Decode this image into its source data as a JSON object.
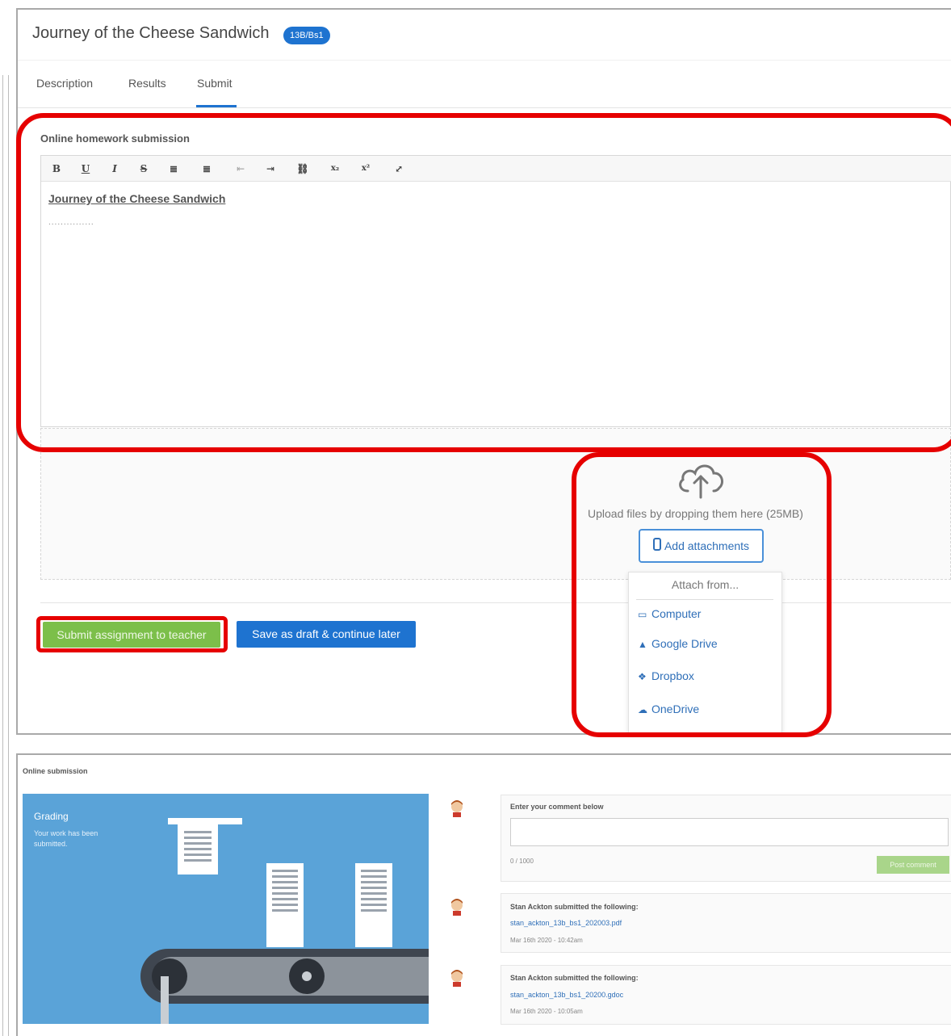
{
  "assignment": {
    "title": "Journey of the Cheese Sandwich",
    "class_badge": "13B/Bs1"
  },
  "tabs": [
    {
      "label": "Description"
    },
    {
      "label": "Results"
    },
    {
      "label": "Submit",
      "active": true
    }
  ],
  "editor": {
    "label": "Online homework submission",
    "toolbar": [
      "B",
      "U",
      "I",
      "S",
      "≣",
      "≣",
      "⇤",
      "⇥",
      "⛓",
      "x₂",
      "x²",
      "⤢"
    ],
    "content_heading": "Journey of the Cheese Sandwich",
    "content_placeholder": "..............."
  },
  "upload": {
    "hint": "Upload files by dropping them here (25MB)",
    "add_button": "Add attachments",
    "menu_title": "Attach from...",
    "menu_items": [
      {
        "label": "Computer",
        "icon": "laptop-icon"
      },
      {
        "label": "Google Drive",
        "icon": "google-drive-icon"
      },
      {
        "label": "Dropbox",
        "icon": "dropbox-icon"
      },
      {
        "label": "OneDrive",
        "icon": "onedrive-icon"
      }
    ]
  },
  "actions": {
    "submit": "Submit assignment to teacher",
    "draft": "Save as draft & continue later"
  },
  "submission_panel": {
    "label": "Online submission",
    "status_title": "Grading",
    "status_text": "Your work has been submitted.",
    "comment_prompt": "Enter your comment below",
    "char_count": "0 / 1000",
    "post_button": "Post comment",
    "entries": [
      {
        "title": "Stan Ackton submitted the following:",
        "file": "stan_ackton_13b_bs1_202003.pdf",
        "date": "Mar 16th 2020 - 10:42am"
      },
      {
        "title": "Stan Ackton submitted the following:",
        "file": "stan_ackton_13b_bs1_20200.gdoc",
        "date": "Mar 16th 2020 - 10:05am"
      }
    ]
  },
  "colors": {
    "primary": "#1e73d0",
    "submit_green": "#7cbf4a",
    "annotation_red": "#e60000",
    "illustration_bg": "#5aa3d8"
  }
}
